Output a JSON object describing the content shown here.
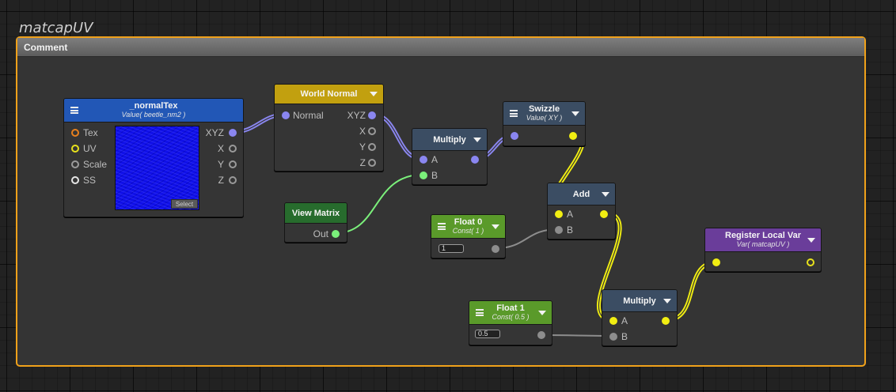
{
  "graph": {
    "group_title": "matcapUV",
    "comment_label": "Comment"
  },
  "colors": {
    "comment_border": "#f0a11a",
    "texture_header": "#2257b6",
    "world_normal_header": "#c2a00f",
    "operator_header": "#3b4d63",
    "const_header": "#5a9a2a",
    "view_matrix_header": "#276c2d",
    "register_header": "#6a3d9a",
    "wire_vector": "#8a86f0",
    "wire_float": "#f1ee12",
    "wire_green": "#7bf07b",
    "wire_gray": "#8d8d8d"
  },
  "icons": {
    "menu": "menu-icon",
    "dropdown": "chevron-down-icon"
  },
  "nodes": {
    "normalTex": {
      "title": "_normalTex",
      "subtitle": "Value( beetle_nm2 )",
      "inputs": [
        "Tex",
        "UV",
        "Scale",
        "SS"
      ],
      "outputs": [
        "XYZ",
        "X",
        "Y",
        "Z"
      ],
      "select_label": "Select"
    },
    "worldNormal": {
      "title": "World Normal",
      "input": "Normal",
      "outputs": [
        "XYZ",
        "X",
        "Y",
        "Z"
      ]
    },
    "multiply1": {
      "title": "Multiply",
      "inputs": [
        "A",
        "B"
      ]
    },
    "swizzle": {
      "title": "Swizzle",
      "subtitle": "Value( XY )"
    },
    "viewMatrix": {
      "title": "View Matrix",
      "output": "Out"
    },
    "add": {
      "title": "Add",
      "inputs": [
        "A",
        "B"
      ]
    },
    "float0": {
      "title": "Float 0",
      "subtitle": "Const( 1 )",
      "value": "1"
    },
    "registerLocalVar": {
      "title": "Register Local Var",
      "subtitle": "Var( matcapUV )"
    },
    "float1": {
      "title": "Float 1",
      "subtitle": "Const( 0.5 )",
      "value": "0.5"
    },
    "multiply2": {
      "title": "Multiply",
      "inputs": [
        "A",
        "B"
      ]
    }
  }
}
